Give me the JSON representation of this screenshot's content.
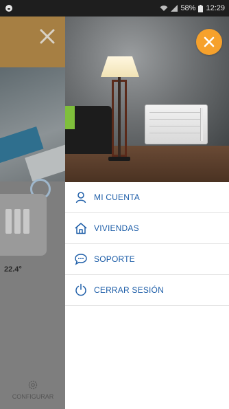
{
  "status_bar": {
    "battery": "58%",
    "time": "12:29"
  },
  "background": {
    "temperature": "22.4°",
    "config_label": "CONFIGURAR"
  },
  "drawer": {
    "menu": [
      {
        "label": "MI CUENTA",
        "icon": "user-icon"
      },
      {
        "label": "VIVIENDAS",
        "icon": "home-icon"
      },
      {
        "label": "SOPORTE",
        "icon": "chat-icon"
      },
      {
        "label": "CERRAR SESIÓN",
        "icon": "power-icon"
      }
    ]
  },
  "colors": {
    "accent_orange": "#f6a12c",
    "menu_text": "#1e5ea8",
    "header_bg": "#a67f43"
  }
}
